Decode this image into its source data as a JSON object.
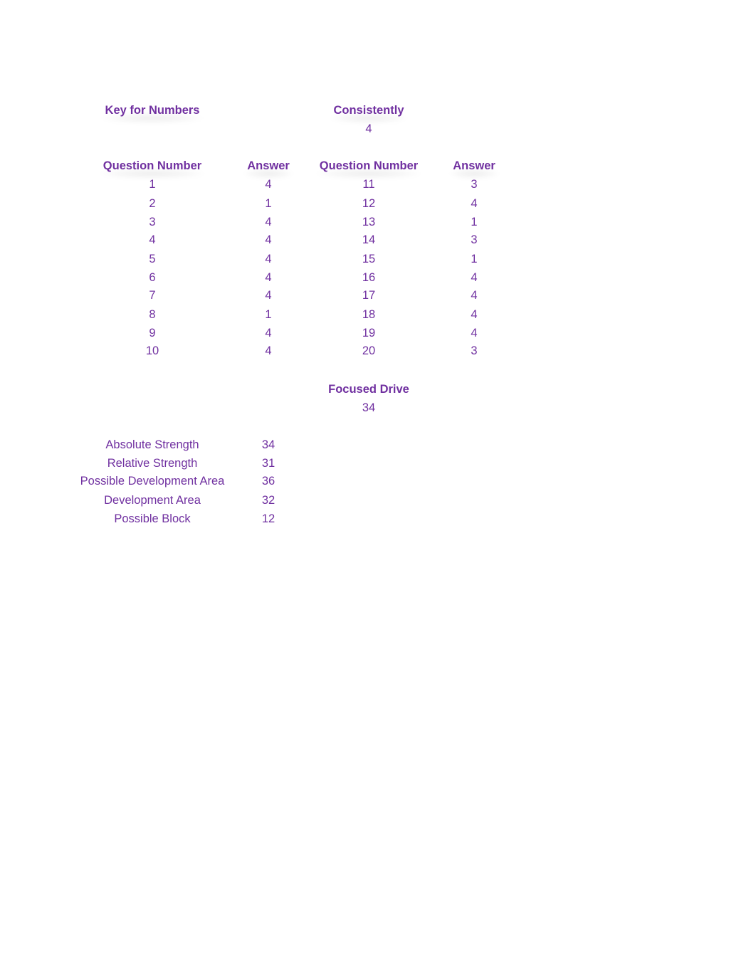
{
  "key_header": "Key for Numbers",
  "consistently": {
    "label": "Consistently",
    "value": "4"
  },
  "table": {
    "headers": [
      "Question Number",
      "Answer",
      "Question Number",
      "Answer"
    ],
    "left": [
      {
        "q": "1",
        "a": "4"
      },
      {
        "q": "2",
        "a": "1"
      },
      {
        "q": "3",
        "a": "4"
      },
      {
        "q": "4",
        "a": "4"
      },
      {
        "q": "5",
        "a": "4"
      },
      {
        "q": "6",
        "a": "4"
      },
      {
        "q": "7",
        "a": "4"
      },
      {
        "q": "8",
        "a": "1"
      },
      {
        "q": "9",
        "a": "4"
      },
      {
        "q": "10",
        "a": "4"
      }
    ],
    "right": [
      {
        "q": "11",
        "a": "3"
      },
      {
        "q": "12",
        "a": "4"
      },
      {
        "q": "13",
        "a": "1"
      },
      {
        "q": "14",
        "a": "3"
      },
      {
        "q": "15",
        "a": "1"
      },
      {
        "q": "16",
        "a": "4"
      },
      {
        "q": "17",
        "a": "4"
      },
      {
        "q": "18",
        "a": "4"
      },
      {
        "q": "19",
        "a": "4"
      },
      {
        "q": "20",
        "a": "3"
      }
    ]
  },
  "focused_drive": {
    "label": "Focused Drive",
    "value": "34"
  },
  "scores": [
    {
      "label": "Absolute Strength",
      "value": "34"
    },
    {
      "label": "Relative Strength",
      "value": "31"
    },
    {
      "label": "Possible Development Area",
      "value": "36"
    },
    {
      "label": "Development Area",
      "value": "32"
    },
    {
      "label": "Possible Block",
      "value": "12"
    }
  ],
  "colors": {
    "text": "#7030A0",
    "background": "#FFFFFF"
  }
}
